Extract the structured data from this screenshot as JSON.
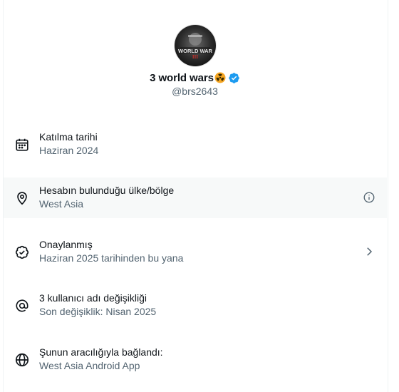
{
  "profile": {
    "name": "3 world wars",
    "handle": "@brs2643",
    "avatar_text_line1": "WORLD WAR",
    "avatar_text_line2": "III",
    "verified": true,
    "emoji_icon": "radioactive-emoji-icon"
  },
  "rows": [
    {
      "label": "Katılma tarihi",
      "value": "Haziran 2024",
      "icon": "calendar-icon"
    },
    {
      "label": "Hesabın bulunduğu ülke/bölge",
      "value": "West Asia",
      "icon": "location-pin-icon",
      "right_icon": "info-icon"
    },
    {
      "label": "Onaylanmış",
      "value": "Haziran 2025 tarihinden bu yana",
      "icon": "verified-check-icon",
      "right_icon": "chevron-right-icon"
    },
    {
      "label": "3 kullanıcı adı değişikliği",
      "value": "Son değişiklik: Nisan 2025",
      "icon": "at-sign-icon"
    },
    {
      "label": "Şunun aracılığıyla bağlandı:",
      "value": "West Asia Android App",
      "icon": "globe-icon"
    }
  ],
  "colors": {
    "text_primary": "#0f1419",
    "text_secondary": "#536471",
    "verified_blue": "#1d9bf0",
    "highlight_bg": "#f7f9f9"
  }
}
